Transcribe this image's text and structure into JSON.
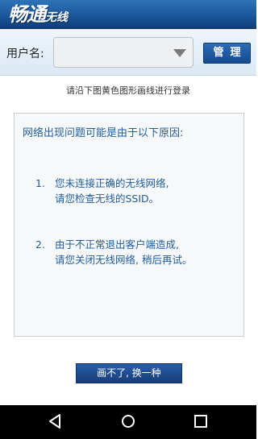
{
  "app": {
    "logo_main": "畅通",
    "logo_sub": "无线"
  },
  "user_bar": {
    "label": "用户名:",
    "selected_value": "",
    "manage_label": "管理"
  },
  "instruction": "请沿下图黄色图形画线进行登录",
  "error_panel": {
    "title": "网络出现问题可能是由于以下原因:",
    "reasons": [
      {
        "number": "1.",
        "line1": "您未连接正确的无线网络,",
        "line2": "请您检查无线的SSID。"
      },
      {
        "number": "2.",
        "line1": "由于不正常退出客户端造成,",
        "line2": "请您关闭无线网络, 稍后再试。"
      }
    ]
  },
  "retry_button": "画不了, 换一种",
  "nav_icons": [
    "back-icon",
    "home-icon",
    "recent-apps-icon"
  ],
  "colors": {
    "header_blue": "#1b579c",
    "panel_text": "#1f5d9c",
    "button_blue": "#163d7b"
  }
}
